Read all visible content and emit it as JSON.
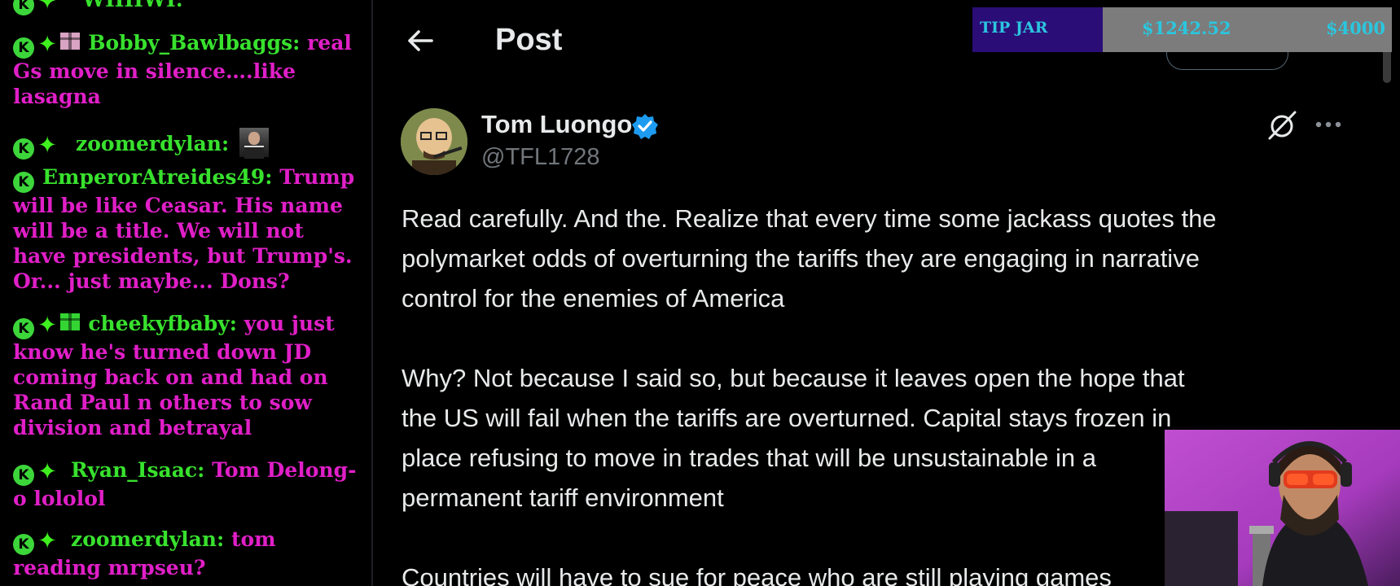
{
  "chat": {
    "messages": [
      {
        "username": "WIIIIWI:",
        "text": "",
        "has_gift": false
      },
      {
        "username": "Bobby_Bawlbaggs:",
        "text": "real Gs move in silence….like lasagna",
        "has_gift": true,
        "gift_color": "#d9a3c3"
      },
      {
        "username": "zoomerdylan:",
        "text": "",
        "has_gift": false,
        "emote": "portrait-emote"
      },
      {
        "username": "EmperorAtreides49:",
        "text": "Trump will be like Ceasar. His name will be a title. We will not have presidents, but Trump's. Or... just maybe... Dons?",
        "has_gift": false
      },
      {
        "username": "cheekyfbaby:",
        "text": "you just know he's turned down JD coming back on and had on Rand Paul n others to sow division and betrayal",
        "has_gift": true,
        "gift_color": "#34d533"
      },
      {
        "username": "Ryan_Isaac:",
        "text": "Tom Delong-o lololol",
        "has_gift": false
      },
      {
        "username": "zoomerdylan:",
        "text": "tom reading mrpseu?",
        "has_gift": false
      }
    ],
    "badge_letter": "K",
    "star_glyph": "✦",
    "colors": {
      "username": "#38e12e",
      "text": "#e01fc7",
      "badge": "#3cd63a"
    }
  },
  "tweet": {
    "page_title": "Post",
    "author": {
      "name": "Tom Luongo",
      "handle": "@TFL1728",
      "verified": true
    },
    "body": "Read carefully.  And the. Realize that every time some jackass quotes the\npolymarket odds of overturning the tariffs they are engaging in narrative\ncontrol for the enemies of America\n\nWhy?  Not because I said so, but because it leaves open the hope that\nthe US will fail when the tariffs are overturned.  Capital stays frozen in\nplace refusing to move in trades that will be unsustainable in a\npermanent tariff environment\n\nCountries will have to sue for peace who are still playing games",
    "icons": [
      "back-arrow-icon",
      "verified-badge-icon",
      "grok-icon",
      "more-icon"
    ],
    "colors": {
      "text": "#e7e9ea",
      "secondary": "#71767b",
      "verified": "#1d9bf0"
    }
  },
  "tip_jar": {
    "label": "TIP JAR",
    "current": "$1242.52",
    "goal": "$4000",
    "progress_fraction": 0.31,
    "colors": {
      "label_bg": "#2b0d78",
      "bar_bg": "#7c7c7c",
      "text": "#2bc6de"
    }
  },
  "webcam": {
    "present": true
  }
}
